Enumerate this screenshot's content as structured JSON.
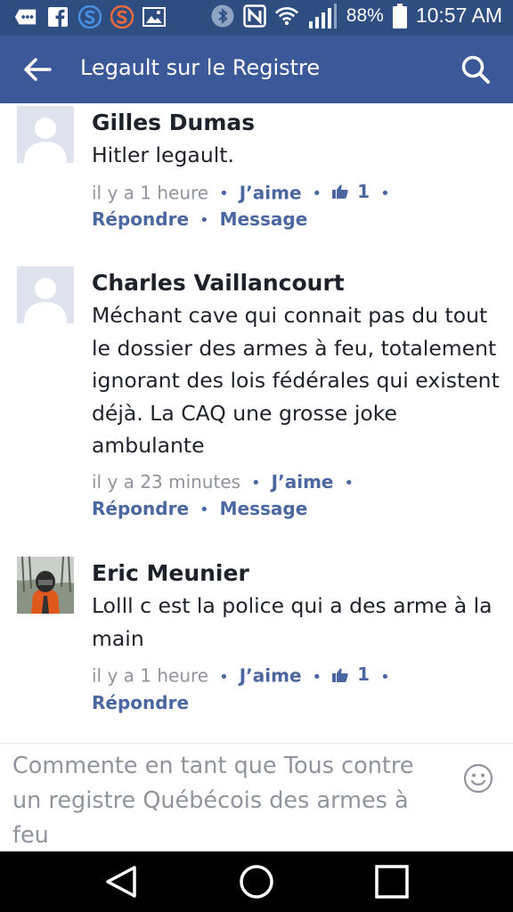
{
  "status_bar": {
    "battery": "88%",
    "time": "10:57 AM"
  },
  "app_bar": {
    "title": "Legault sur le Registre"
  },
  "comments": [
    {
      "name": "Gilles Dumas",
      "text": "Hitler legault.",
      "time": "il y a 1 heure",
      "like_label": "J’aime",
      "like_count": "1",
      "reply_label": "Répondre",
      "message_label": "Message"
    },
    {
      "name": "Charles Vaillancourt",
      "text": "Méchant cave qui connait pas du tout le dossier des armes à feu, totalement ignorant des lois fédérales qui existent déjà.  La CAQ une grosse joke ambulante",
      "time": "il y a 23 minutes",
      "like_label": "J’aime",
      "reply_label": "Répondre",
      "message_label": "Message"
    },
    {
      "name": "Eric Meunier",
      "text": "Lolll c est la police qui a des arme à la main",
      "time": "il y a 1 heure",
      "like_label": "J’aime",
      "like_count": "1",
      "reply_label": "Répondre"
    }
  ],
  "composer": {
    "placeholder": "Commente en tant que Tous contre un registre Québécois des armes à feu"
  },
  "icons": {
    "status": [
      "messenger-icon",
      "facebook-icon",
      "app-s-blue-icon",
      "app-s-orange-icon",
      "gallery-icon",
      "bluetooth-icon",
      "nfc-icon",
      "wifi-icon",
      "signal-icon",
      "battery-icon"
    ],
    "app_bar": [
      "back-arrow-icon",
      "search-icon"
    ],
    "nav": [
      "nav-back-icon",
      "nav-home-icon",
      "nav-recents-icon"
    ]
  },
  "colors": {
    "status_bar": "#2e4e82",
    "app_bar": "#3b5998",
    "link": "#4b67a1",
    "meta": "#90949c",
    "text": "#1d2129",
    "nav_bar": "#000000"
  }
}
